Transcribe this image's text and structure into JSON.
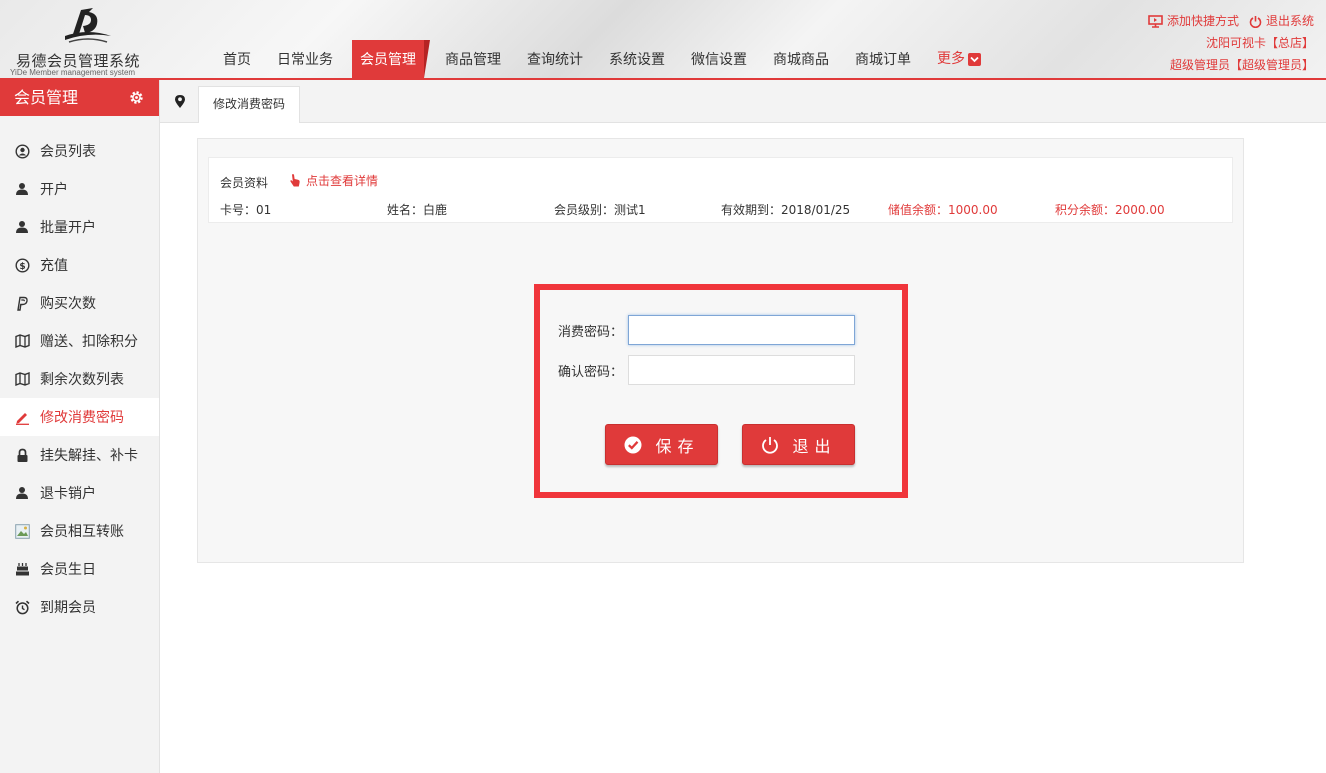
{
  "app": {
    "title": "易德会员管理系统",
    "subtitle": "YiDe Member management system"
  },
  "nav": {
    "items": [
      "首页",
      "日常业务",
      "会员管理",
      "商品管理",
      "查询统计",
      "系统设置",
      "微信设置",
      "商城商品",
      "商城订单"
    ],
    "active_index": 2,
    "more_label": "更多"
  },
  "top_right": {
    "add_shortcut": "添加快捷方式",
    "logout": "退出系统",
    "store": "沈阳可视卡【总店】",
    "user": "超级管理员【超级管理员】"
  },
  "sidebar": {
    "title": "会员管理",
    "items": [
      {
        "label": "会员列表",
        "icon": "user-circle-icon"
      },
      {
        "label": "开户",
        "icon": "user-icon"
      },
      {
        "label": "批量开户",
        "icon": "user-icon"
      },
      {
        "label": "充值",
        "icon": "dollar-circle-icon"
      },
      {
        "label": "购买次数",
        "icon": "paypal-icon"
      },
      {
        "label": "赠送、扣除积分",
        "icon": "map-icon"
      },
      {
        "label": "剩余次数列表",
        "icon": "map-icon"
      },
      {
        "label": "修改消费密码",
        "icon": "pencil-icon"
      },
      {
        "label": "挂失解挂、补卡",
        "icon": "lock-icon"
      },
      {
        "label": "退卡销户",
        "icon": "user-icon"
      },
      {
        "label": "会员相互转账",
        "icon": "picture-icon"
      },
      {
        "label": "会员生日",
        "icon": "cake-icon"
      },
      {
        "label": "到期会员",
        "icon": "alarm-clock-icon"
      }
    ],
    "active_index": 7
  },
  "tab": {
    "label": "修改消费密码"
  },
  "member": {
    "section_label": "会员资料",
    "detail_link": "点击查看详情",
    "card_no": "卡号：01",
    "name": "姓名：白鹿",
    "level": "会员级别：测试1",
    "expiry": "有效期到：2018/01/25",
    "balance": "储值余额：1000.00",
    "points": "积分余额：2000.00"
  },
  "form": {
    "password_label": "消费密码：",
    "password_value": "",
    "confirm_label": "确认密码：",
    "confirm_value": "",
    "save_label": "保存",
    "exit_label": "退出"
  },
  "colors": {
    "accent": "#e03a3a",
    "highlight_border": "#f0353b"
  }
}
